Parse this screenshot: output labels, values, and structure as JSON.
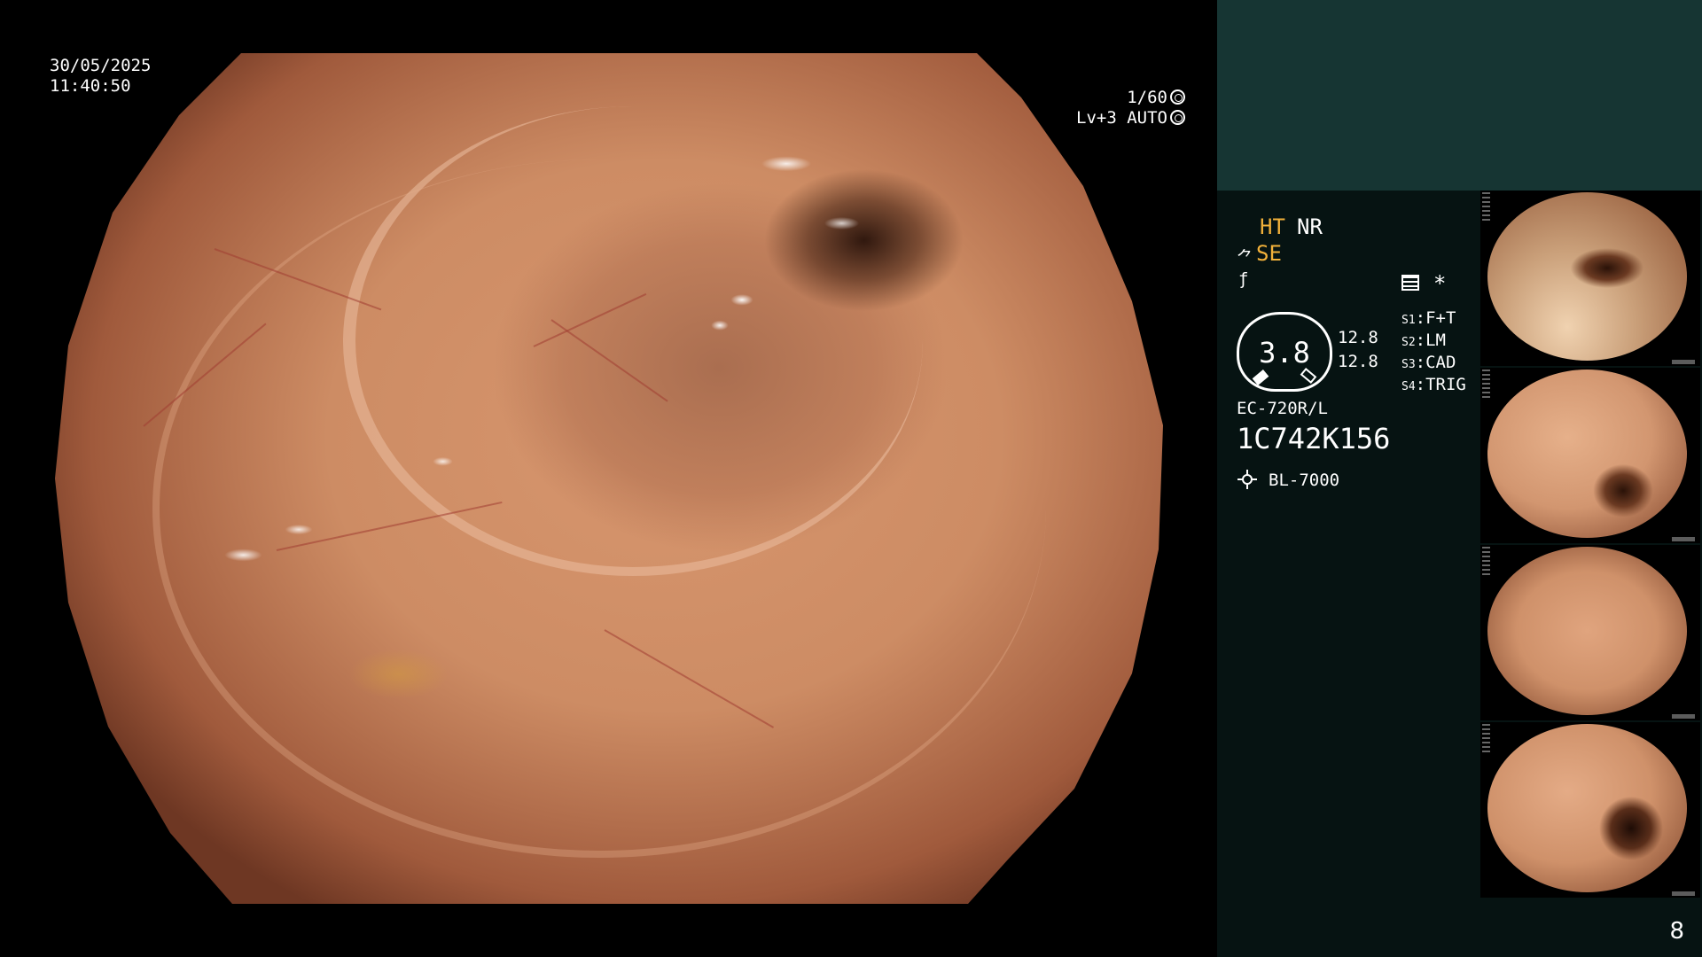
{
  "overlay": {
    "date": "30/05/2025",
    "time": "11:40:50",
    "shutter": "1/60",
    "shutter_icon": "aperture-icon",
    "level_mode": "Lv+3 AUTO",
    "level_icon": "auto-iris-icon"
  },
  "settings": {
    "ht": "HT",
    "nr": "NR",
    "se_symbol": "⺈",
    "se": "SE",
    "edge_symbol": "ƒ",
    "memo_icon": "memo-icon",
    "asterisk": "*",
    "iris_value": "3.8",
    "side_value_top": "12.8",
    "side_value_bottom": "12.8",
    "switches": [
      {
        "key": "S1",
        "value": "F+T"
      },
      {
        "key": "S2",
        "value": "LM"
      },
      {
        "key": "S3",
        "value": "CAD"
      },
      {
        "key": "S4",
        "value": "TRIG"
      }
    ],
    "scope_model": "EC-720R/L",
    "serial": "1C742K156",
    "light_source": "BL-7000",
    "light_icon": "bulb-icon"
  },
  "thumbnails": [
    {
      "label": "captured-frame-1"
    },
    {
      "label": "captured-frame-2"
    },
    {
      "label": "captured-frame-3"
    },
    {
      "label": "captured-frame-4"
    }
  ],
  "page_number": "8",
  "colors": {
    "panel_bg": "#061312",
    "panel_top": "#163533",
    "accent_amber": "#f2b13a",
    "tissue": "#d29670"
  }
}
